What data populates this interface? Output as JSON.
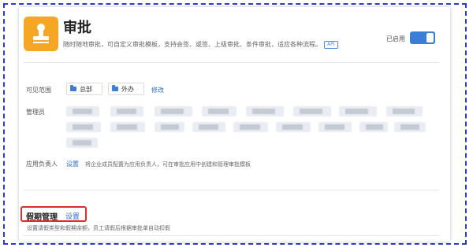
{
  "app": {
    "title": "审批",
    "description": "随时随地审批，可自定义审批模板，支持会签、或签、上级审批、条件审批，适应各种流程。",
    "api_badge": "API",
    "status_label": "已启用",
    "toggle_on": true,
    "icon": "person-stamp-icon",
    "icon_color": "#f5a623"
  },
  "visibility": {
    "label": "可见范围",
    "chips": [
      "总部",
      "外办"
    ],
    "edit_link": "修改"
  },
  "admins": {
    "label": "管理员",
    "note": "names blurred in screenshot",
    "count": 20
  },
  "owner": {
    "label": "应用负责人",
    "setting_link": "设置",
    "description": "将企业成员配置为应用负责人，可在审批应用中创建和管理审批模板"
  },
  "holiday": {
    "title": "假期管理",
    "setting_link": "设置",
    "description": "设置请假类型和假期余额，员工请假后根据审批单自动扣假"
  },
  "colors": {
    "accent": "#2f6fd6",
    "toggle": "#3b7ed8",
    "highlight_border": "#e02b2b",
    "frame": "#2c3cc8"
  }
}
